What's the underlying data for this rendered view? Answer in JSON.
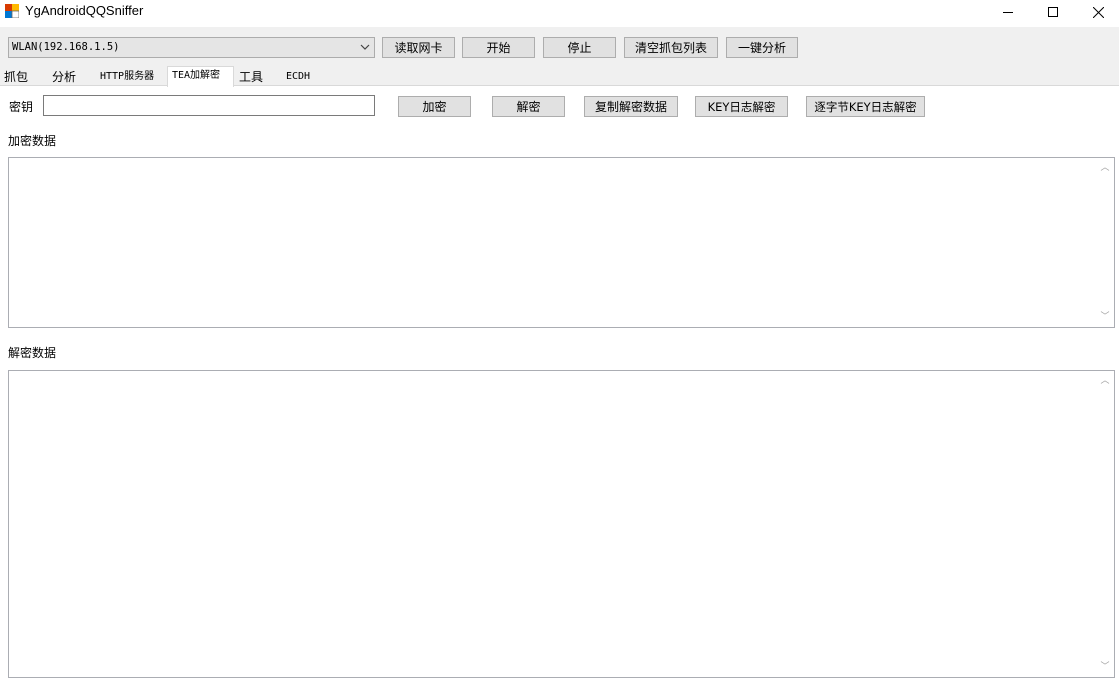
{
  "window": {
    "title": "YgAndroidQQSniffer",
    "app_icon": "app-icon",
    "controls": {
      "minimize": "─",
      "maximize": "☐",
      "close": "✕"
    }
  },
  "toolbar": {
    "adapter_selected": "WLAN(192.168.1.5)",
    "read_nic_label": "读取网卡",
    "start_label": "开始",
    "stop_label": "停止",
    "clear_label": "清空抓包列表",
    "analyze_label": "一键分析"
  },
  "tabs": [
    "抓包",
    "分析",
    "HTTP服务器",
    "TEA加解密",
    "工具",
    "ECDH"
  ],
  "active_tab": "TEA加解密",
  "tea": {
    "key_label": "密钥",
    "key_value": "",
    "encrypt_label": "加密",
    "decrypt_label": "解密",
    "copy_label": "复制解密数据",
    "key_log_label": "KEY日志解密",
    "byte_key_log_label": "逐字节KEY日志解密",
    "encrypted_label": "加密数据",
    "encrypted_value": "",
    "decrypted_label": "解密数据",
    "decrypted_value": ""
  },
  "colors": {
    "toolbar_bg": "#f0f0f0",
    "button_bg": "#e1e1e1",
    "button_border": "#adadad"
  }
}
